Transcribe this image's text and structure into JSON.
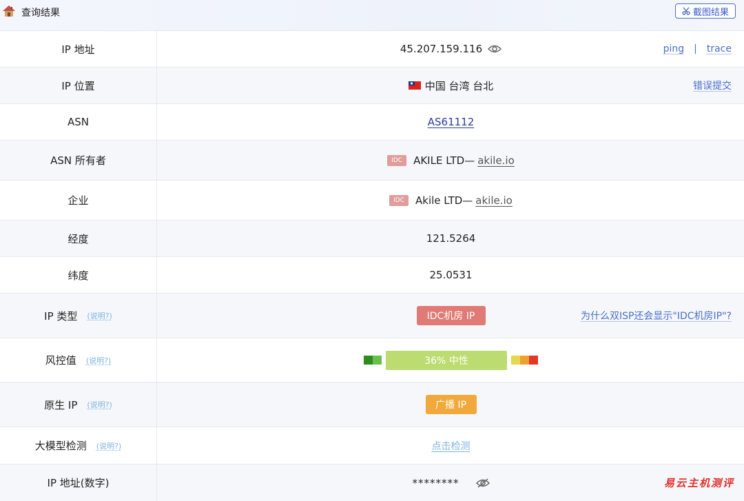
{
  "header": {
    "title": "查询结果",
    "screenshot_label": "截图结果",
    "house_icon": "house-icon",
    "scissors_icon": "scissors-icon"
  },
  "rows": {
    "ip": {
      "label": "IP 地址",
      "value": "45.207.159.116",
      "ping": "ping",
      "separator": "|",
      "trace": "trace"
    },
    "location": {
      "label": "IP 位置",
      "value": "中国 台湾 台北",
      "report": "错误提交"
    },
    "asn": {
      "label": "ASN",
      "value": "AS61112"
    },
    "asn_owner": {
      "label": "ASN 所有者",
      "tag": "IDC",
      "name": "AKILE LTD—",
      "domain": "akile.io"
    },
    "company": {
      "label": "企业",
      "tag": "IDC",
      "name": "Akile LTD—",
      "domain": "akile.io"
    },
    "longitude": {
      "label": "经度",
      "value": "121.5264"
    },
    "latitude": {
      "label": "纬度",
      "value": "25.0531"
    },
    "ip_type": {
      "label": "IP 类型",
      "explain": "(说明?)",
      "value": "IDC机房 IP",
      "question": "为什么双ISP还会显示\"IDC机房IP\"?"
    },
    "risk": {
      "label": "风控值",
      "explain": "(说明?)",
      "value": "36%  中性",
      "percent": 36
    },
    "native_ip": {
      "label": "原生 IP",
      "explain": "(说明?)",
      "value": "广播 IP"
    },
    "llm_check": {
      "label": "大模型检测",
      "explain": "(说明?)",
      "value": "点击检测"
    },
    "ip_numeric": {
      "label": "IP 地址(数字)",
      "value": "********",
      "watermark": "易云主机测评"
    }
  },
  "colors": {
    "idc_red": "#e07a74",
    "broadcast_orange": "#f2a93b",
    "risk_green": "#bcdc72",
    "link_blue": "#4a6fc9"
  }
}
